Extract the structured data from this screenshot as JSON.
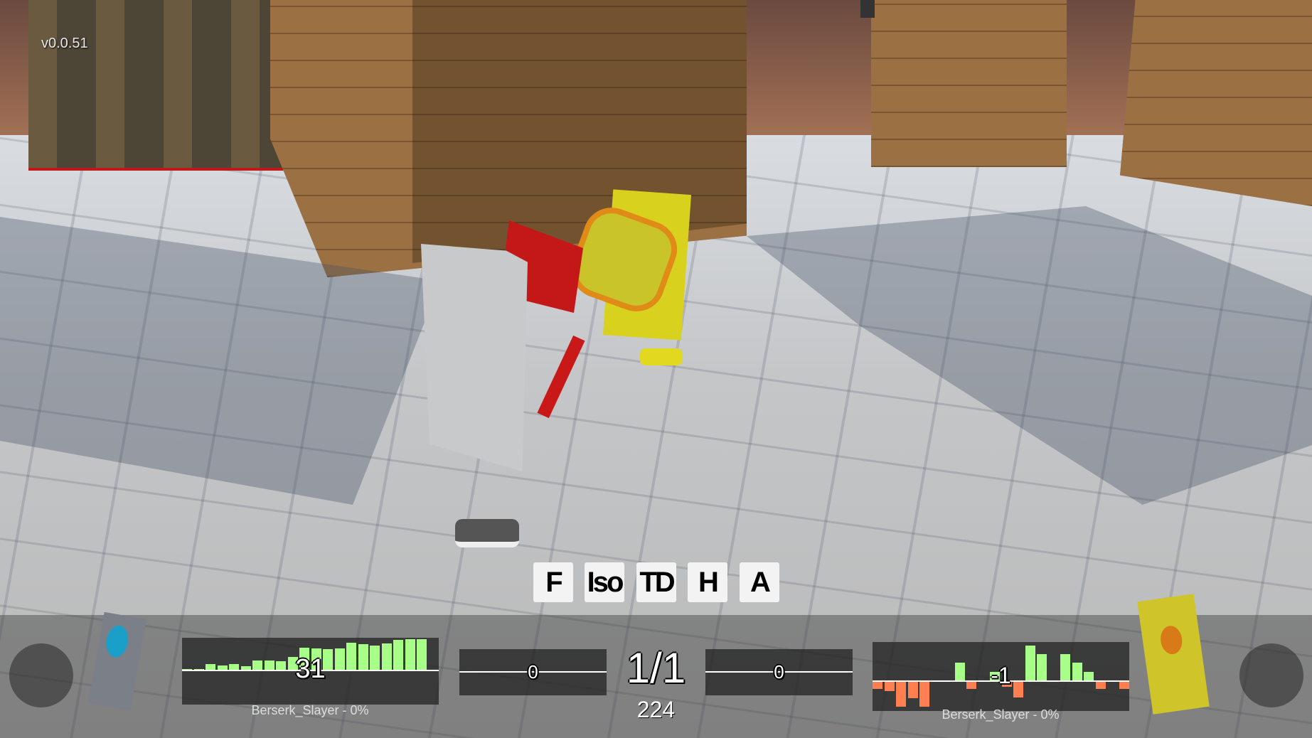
{
  "version": "v0.0.51",
  "camera_buttons": [
    {
      "label": "F"
    },
    {
      "label": "Iso"
    },
    {
      "label": "TD"
    },
    {
      "label": "H"
    },
    {
      "label": "A"
    }
  ],
  "hud": {
    "round": "1/1",
    "timer": "224",
    "left_player": {
      "name_label": "Berserk_Slayer - 0%",
      "graph_value": "31",
      "box_value": "0",
      "graph_bars": [
        1,
        1,
        9,
        7,
        9,
        6,
        14,
        15,
        13,
        20,
        35,
        33,
        32,
        33,
        42,
        40,
        38,
        41,
        47,
        48,
        48
      ],
      "colors": {
        "positive": "#a8ff88",
        "negative": "#ff7f50"
      }
    },
    "right_player": {
      "name_label": "Berserk_Slayer - 0%",
      "graph_value": "-1",
      "box_value": "0",
      "graph_bars": [
        -10,
        -13,
        -35,
        -23,
        -35,
        0,
        0,
        25,
        -10,
        0,
        12,
        -7,
        -22,
        49,
        37,
        0,
        37,
        25,
        12,
        -10,
        0,
        -10
      ]
    }
  }
}
